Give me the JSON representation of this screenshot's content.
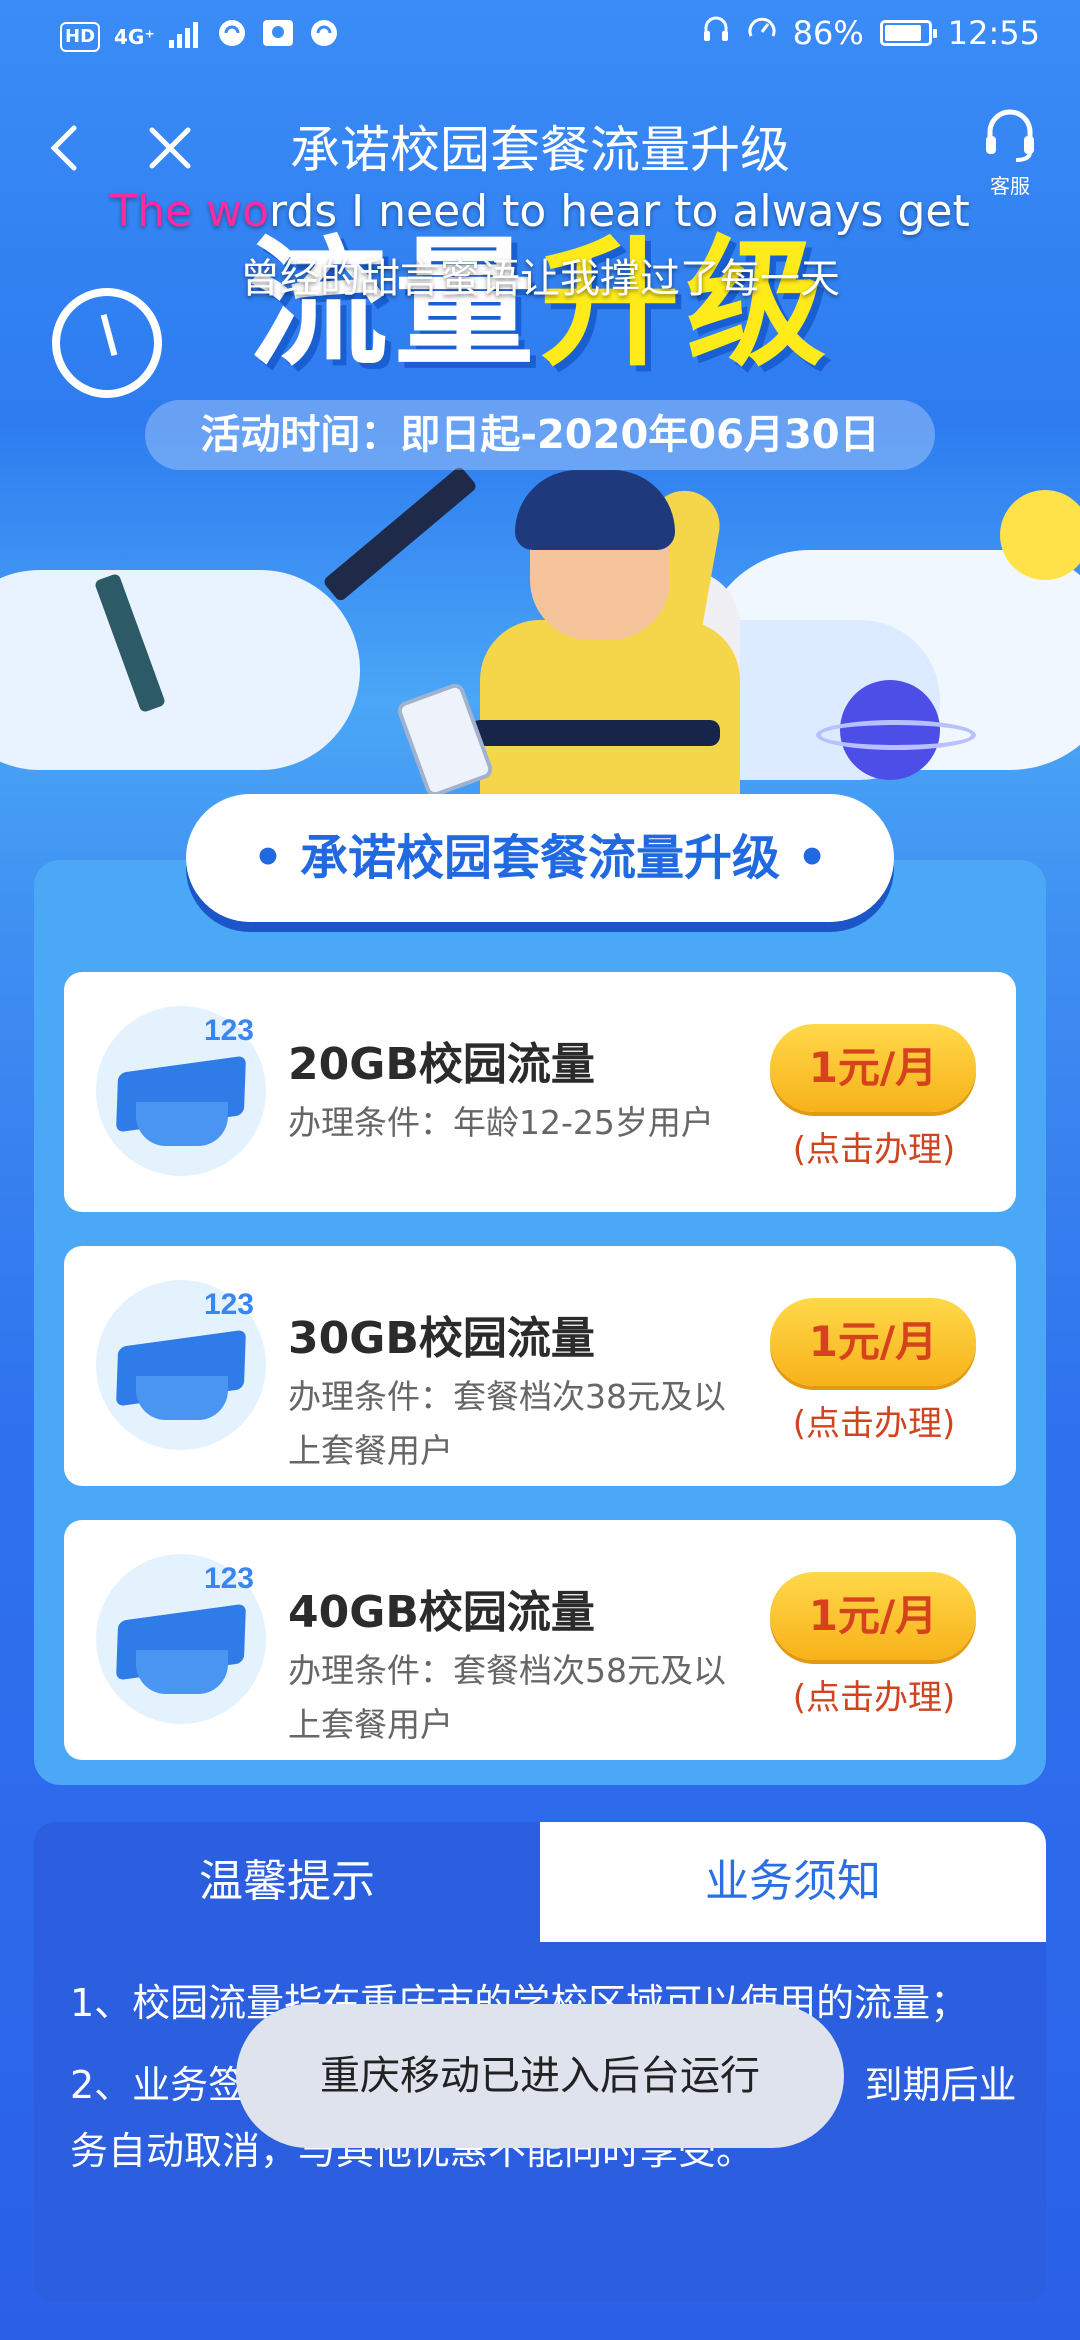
{
  "status_bar": {
    "left_icons": [
      "hd-icon",
      "4g-signal-icon",
      "signal-bars-icon",
      "wifi-calling-icon",
      "sim-icon",
      "wifi-calling-icon"
    ],
    "hd_label": "HD",
    "network_label": "4G⁺",
    "battery_percent": "86%",
    "time": "12:55",
    "battery_level": 0.86
  },
  "nav": {
    "back_icon": "‹",
    "close_icon": "✕",
    "title": "承诺校园套餐流量升级",
    "service_label": "客服"
  },
  "banner": {
    "subtitle_en_highlight": "The wo",
    "subtitle_en_rest": "rds I need to hear to always get",
    "subtitle_cn": "曾经的甜言蜜语让我撑过了每一天",
    "big_title_white": "流量",
    "big_title_yellow": "升级",
    "activity_time": "活动时间：即日起-2020年06月30日"
  },
  "section_title": "• 承诺校园套餐流量升级 •",
  "plans": [
    {
      "name": "20GB校园流量",
      "condition": "办理条件：年龄12-25岁用户",
      "badge": "123",
      "button": "1元/月",
      "button_sub": "(点击办理)"
    },
    {
      "name": "30GB校园流量",
      "condition": "办理条件：套餐档次38元及以上套餐用户",
      "badge": "123",
      "button": "1元/月",
      "button_sub": "(点击办理)"
    },
    {
      "name": "40GB校园流量",
      "condition": "办理条件：套餐档次58元及以上套餐用户",
      "badge": "123",
      "button": "1元/月",
      "button_sub": "(点击办理)"
    }
  ],
  "tabs": {
    "tab_a": "温馨提示",
    "tab_b": "业务须知"
  },
  "notice": {
    "item_1": "1、校园流量指在重庆市的学校区域可以使用的流量；",
    "item_2": "2、业务签约期12个月，期间不能降档或销户，到期后业务自动取消，与其他优惠不能同时享受。"
  },
  "toast": "重庆移动已进入后台运行",
  "colors": {
    "accent_blue": "#2b6fe6",
    "button_orange": "#f7b21a",
    "button_text": "#d6421d",
    "title_yellow": "#ffea1a"
  }
}
